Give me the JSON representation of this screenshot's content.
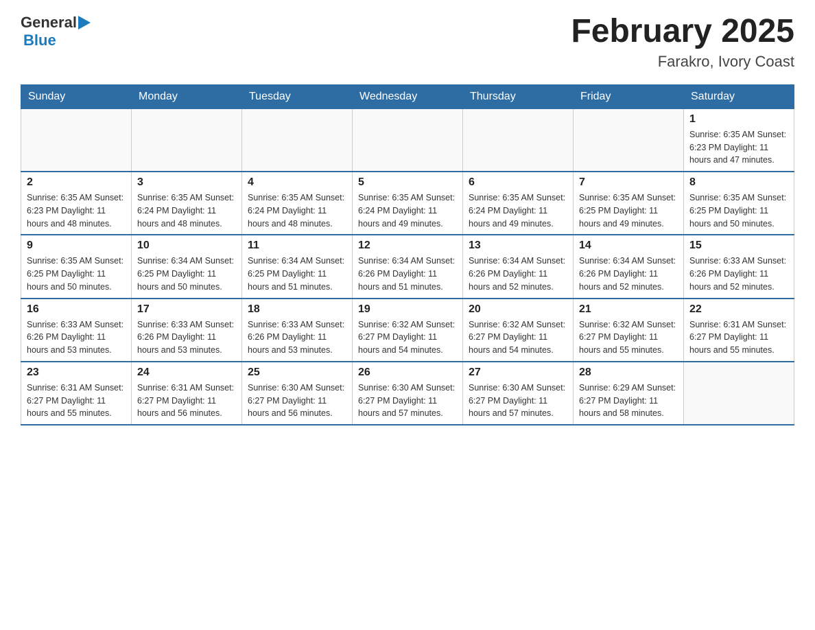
{
  "header": {
    "logo_general": "General",
    "logo_blue": "Blue",
    "title": "February 2025",
    "subtitle": "Farakro, Ivory Coast"
  },
  "days_of_week": [
    "Sunday",
    "Monday",
    "Tuesday",
    "Wednesday",
    "Thursday",
    "Friday",
    "Saturday"
  ],
  "weeks": [
    [
      {
        "day": "",
        "info": ""
      },
      {
        "day": "",
        "info": ""
      },
      {
        "day": "",
        "info": ""
      },
      {
        "day": "",
        "info": ""
      },
      {
        "day": "",
        "info": ""
      },
      {
        "day": "",
        "info": ""
      },
      {
        "day": "1",
        "info": "Sunrise: 6:35 AM\nSunset: 6:23 PM\nDaylight: 11 hours\nand 47 minutes."
      }
    ],
    [
      {
        "day": "2",
        "info": "Sunrise: 6:35 AM\nSunset: 6:23 PM\nDaylight: 11 hours\nand 48 minutes."
      },
      {
        "day": "3",
        "info": "Sunrise: 6:35 AM\nSunset: 6:24 PM\nDaylight: 11 hours\nand 48 minutes."
      },
      {
        "day": "4",
        "info": "Sunrise: 6:35 AM\nSunset: 6:24 PM\nDaylight: 11 hours\nand 48 minutes."
      },
      {
        "day": "5",
        "info": "Sunrise: 6:35 AM\nSunset: 6:24 PM\nDaylight: 11 hours\nand 49 minutes."
      },
      {
        "day": "6",
        "info": "Sunrise: 6:35 AM\nSunset: 6:24 PM\nDaylight: 11 hours\nand 49 minutes."
      },
      {
        "day": "7",
        "info": "Sunrise: 6:35 AM\nSunset: 6:25 PM\nDaylight: 11 hours\nand 49 minutes."
      },
      {
        "day": "8",
        "info": "Sunrise: 6:35 AM\nSunset: 6:25 PM\nDaylight: 11 hours\nand 50 minutes."
      }
    ],
    [
      {
        "day": "9",
        "info": "Sunrise: 6:35 AM\nSunset: 6:25 PM\nDaylight: 11 hours\nand 50 minutes."
      },
      {
        "day": "10",
        "info": "Sunrise: 6:34 AM\nSunset: 6:25 PM\nDaylight: 11 hours\nand 50 minutes."
      },
      {
        "day": "11",
        "info": "Sunrise: 6:34 AM\nSunset: 6:25 PM\nDaylight: 11 hours\nand 51 minutes."
      },
      {
        "day": "12",
        "info": "Sunrise: 6:34 AM\nSunset: 6:26 PM\nDaylight: 11 hours\nand 51 minutes."
      },
      {
        "day": "13",
        "info": "Sunrise: 6:34 AM\nSunset: 6:26 PM\nDaylight: 11 hours\nand 52 minutes."
      },
      {
        "day": "14",
        "info": "Sunrise: 6:34 AM\nSunset: 6:26 PM\nDaylight: 11 hours\nand 52 minutes."
      },
      {
        "day": "15",
        "info": "Sunrise: 6:33 AM\nSunset: 6:26 PM\nDaylight: 11 hours\nand 52 minutes."
      }
    ],
    [
      {
        "day": "16",
        "info": "Sunrise: 6:33 AM\nSunset: 6:26 PM\nDaylight: 11 hours\nand 53 minutes."
      },
      {
        "day": "17",
        "info": "Sunrise: 6:33 AM\nSunset: 6:26 PM\nDaylight: 11 hours\nand 53 minutes."
      },
      {
        "day": "18",
        "info": "Sunrise: 6:33 AM\nSunset: 6:26 PM\nDaylight: 11 hours\nand 53 minutes."
      },
      {
        "day": "19",
        "info": "Sunrise: 6:32 AM\nSunset: 6:27 PM\nDaylight: 11 hours\nand 54 minutes."
      },
      {
        "day": "20",
        "info": "Sunrise: 6:32 AM\nSunset: 6:27 PM\nDaylight: 11 hours\nand 54 minutes."
      },
      {
        "day": "21",
        "info": "Sunrise: 6:32 AM\nSunset: 6:27 PM\nDaylight: 11 hours\nand 55 minutes."
      },
      {
        "day": "22",
        "info": "Sunrise: 6:31 AM\nSunset: 6:27 PM\nDaylight: 11 hours\nand 55 minutes."
      }
    ],
    [
      {
        "day": "23",
        "info": "Sunrise: 6:31 AM\nSunset: 6:27 PM\nDaylight: 11 hours\nand 55 minutes."
      },
      {
        "day": "24",
        "info": "Sunrise: 6:31 AM\nSunset: 6:27 PM\nDaylight: 11 hours\nand 56 minutes."
      },
      {
        "day": "25",
        "info": "Sunrise: 6:30 AM\nSunset: 6:27 PM\nDaylight: 11 hours\nand 56 minutes."
      },
      {
        "day": "26",
        "info": "Sunrise: 6:30 AM\nSunset: 6:27 PM\nDaylight: 11 hours\nand 57 minutes."
      },
      {
        "day": "27",
        "info": "Sunrise: 6:30 AM\nSunset: 6:27 PM\nDaylight: 11 hours\nand 57 minutes."
      },
      {
        "day": "28",
        "info": "Sunrise: 6:29 AM\nSunset: 6:27 PM\nDaylight: 11 hours\nand 58 minutes."
      },
      {
        "day": "",
        "info": ""
      }
    ]
  ]
}
